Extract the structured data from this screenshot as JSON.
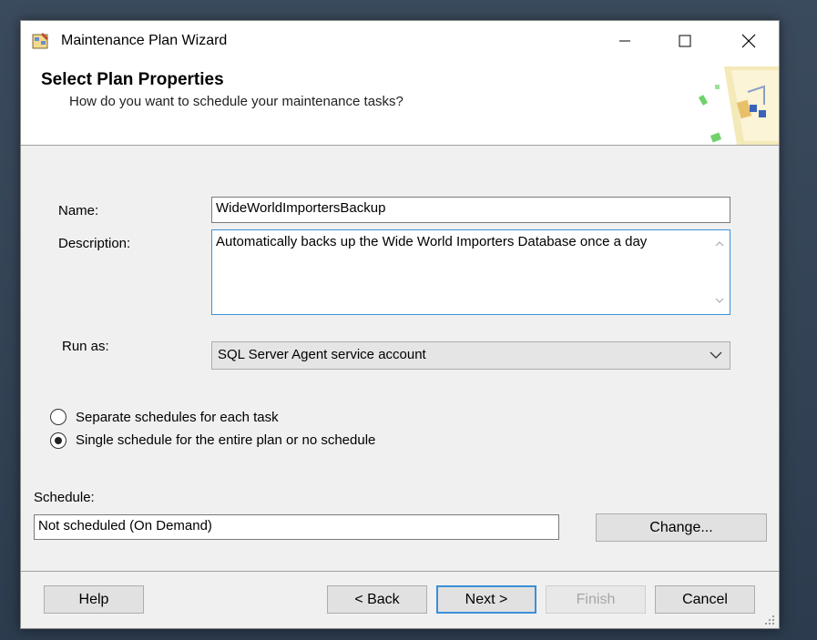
{
  "window": {
    "title": "Maintenance Plan Wizard"
  },
  "header": {
    "title": "Select Plan Properties",
    "subtitle": "How do you want to schedule your maintenance tasks?"
  },
  "form": {
    "name_label": "Name:",
    "name_value": "WideWorldImportersBackup",
    "description_label": "Description:",
    "description_value": "Automatically backs up the Wide World Importers Database once a day",
    "run_as_label": "Run as:",
    "run_as_selected": "SQL Server Agent service account",
    "options": [
      {
        "label": "Separate schedules for each task",
        "selected": false
      },
      {
        "label": "Single schedule for the entire plan or no schedule",
        "selected": true
      }
    ],
    "schedule_label": "Schedule:",
    "schedule_value": "Not scheduled (On Demand)",
    "change_button": "Change..."
  },
  "footer": {
    "help": "Help",
    "back": "< Back",
    "next": "Next >",
    "finish": "Finish",
    "cancel": "Cancel"
  },
  "colors": {
    "accent": "#3c8fd8",
    "background": "#f0f0f0",
    "disabled_text": "#a6a6a6"
  },
  "icons": [
    "wizard-app-icon",
    "minimize-icon",
    "maximize-icon",
    "close-icon",
    "header-wizard-graphic",
    "chevron-up-icon",
    "chevron-down-icon",
    "resize-grip-icon"
  ]
}
